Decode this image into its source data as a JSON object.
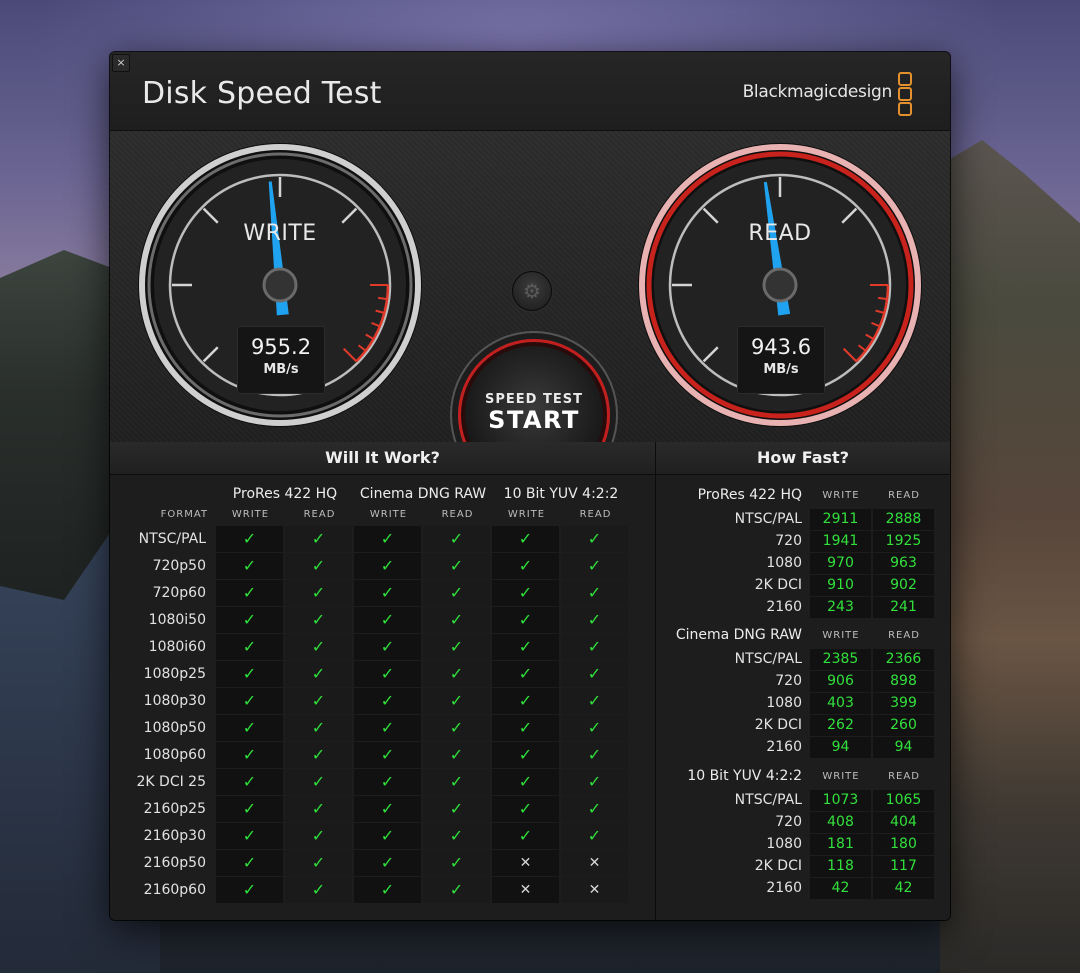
{
  "window": {
    "title": "Disk Speed Test",
    "brand": "Blackmagicdesign",
    "close_label": "×"
  },
  "gauges": {
    "write": {
      "label": "WRITE",
      "value": "955.2",
      "unit": "MB/s",
      "needle_fraction": 0.48
    },
    "read": {
      "label": "READ",
      "value": "943.6",
      "unit": "MB/s",
      "needle_fraction": 0.47
    },
    "start_button": {
      "top": "SPEED TEST",
      "main": "START"
    },
    "settings_icon": "gear-icon"
  },
  "colors": {
    "accent_red": "#c41f1f",
    "ok_green": "#2fe03a",
    "brand_orange": "#e5902e"
  },
  "will_it_work": {
    "title": "Will It Work?",
    "format_label": "FORMAT",
    "groups": [
      {
        "name": "ProRes 422 HQ",
        "cols": [
          "WRITE",
          "READ"
        ]
      },
      {
        "name": "Cinema DNG RAW",
        "cols": [
          "WRITE",
          "READ"
        ]
      },
      {
        "name": "10 Bit YUV 4:2:2",
        "cols": [
          "WRITE",
          "READ"
        ]
      }
    ],
    "ok_glyph": "✓",
    "no_glyph": "✕",
    "rows": [
      {
        "format": "NTSC/PAL",
        "cells": [
          1,
          1,
          1,
          1,
          1,
          1
        ]
      },
      {
        "format": "720p50",
        "cells": [
          1,
          1,
          1,
          1,
          1,
          1
        ]
      },
      {
        "format": "720p60",
        "cells": [
          1,
          1,
          1,
          1,
          1,
          1
        ]
      },
      {
        "format": "1080i50",
        "cells": [
          1,
          1,
          1,
          1,
          1,
          1
        ]
      },
      {
        "format": "1080i60",
        "cells": [
          1,
          1,
          1,
          1,
          1,
          1
        ]
      },
      {
        "format": "1080p25",
        "cells": [
          1,
          1,
          1,
          1,
          1,
          1
        ]
      },
      {
        "format": "1080p30",
        "cells": [
          1,
          1,
          1,
          1,
          1,
          1
        ]
      },
      {
        "format": "1080p50",
        "cells": [
          1,
          1,
          1,
          1,
          1,
          1
        ]
      },
      {
        "format": "1080p60",
        "cells": [
          1,
          1,
          1,
          1,
          1,
          1
        ]
      },
      {
        "format": "2K DCI 25",
        "cells": [
          1,
          1,
          1,
          1,
          1,
          1
        ]
      },
      {
        "format": "2160p25",
        "cells": [
          1,
          1,
          1,
          1,
          1,
          1
        ]
      },
      {
        "format": "2160p30",
        "cells": [
          1,
          1,
          1,
          1,
          1,
          1
        ]
      },
      {
        "format": "2160p50",
        "cells": [
          1,
          1,
          1,
          1,
          0,
          0
        ]
      },
      {
        "format": "2160p60",
        "cells": [
          1,
          1,
          1,
          1,
          0,
          0
        ]
      }
    ]
  },
  "how_fast": {
    "title": "How Fast?",
    "col_write": "WRITE",
    "col_read": "READ",
    "groups": [
      {
        "name": "ProRes 422 HQ",
        "rows": [
          {
            "label": "NTSC/PAL",
            "write": "2911",
            "read": "2888"
          },
          {
            "label": "720",
            "write": "1941",
            "read": "1925"
          },
          {
            "label": "1080",
            "write": "970",
            "read": "963"
          },
          {
            "label": "2K DCI",
            "write": "910",
            "read": "902"
          },
          {
            "label": "2160",
            "write": "243",
            "read": "241"
          }
        ]
      },
      {
        "name": "Cinema DNG RAW",
        "rows": [
          {
            "label": "NTSC/PAL",
            "write": "2385",
            "read": "2366"
          },
          {
            "label": "720",
            "write": "906",
            "read": "898"
          },
          {
            "label": "1080",
            "write": "403",
            "read": "399"
          },
          {
            "label": "2K DCI",
            "write": "262",
            "read": "260"
          },
          {
            "label": "2160",
            "write": "94",
            "read": "94"
          }
        ]
      },
      {
        "name": "10 Bit YUV 4:2:2",
        "rows": [
          {
            "label": "NTSC/PAL",
            "write": "1073",
            "read": "1065"
          },
          {
            "label": "720",
            "write": "408",
            "read": "404"
          },
          {
            "label": "1080",
            "write": "181",
            "read": "180"
          },
          {
            "label": "2K DCI",
            "write": "118",
            "read": "117"
          },
          {
            "label": "2160",
            "write": "42",
            "read": "42"
          }
        ]
      }
    ]
  }
}
